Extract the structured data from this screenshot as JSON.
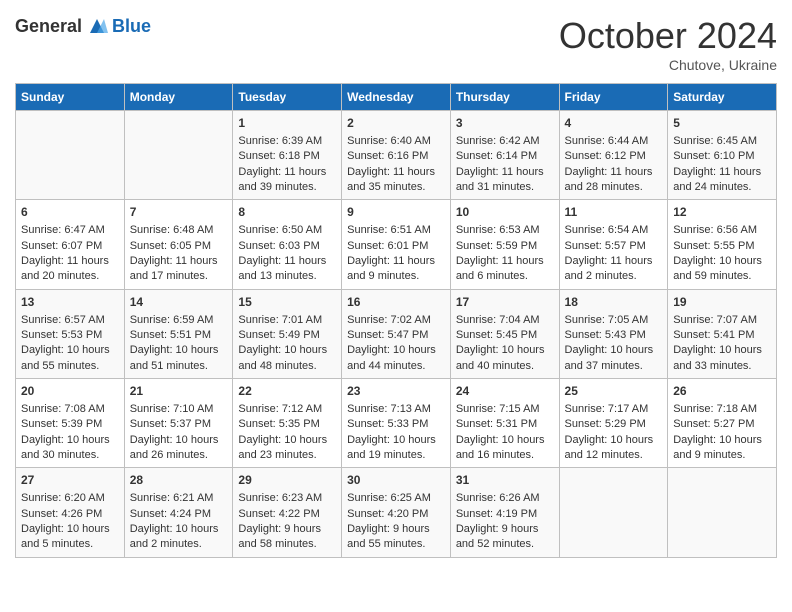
{
  "header": {
    "logo_general": "General",
    "logo_blue": "Blue",
    "month_title": "October 2024",
    "subtitle": "Chutove, Ukraine"
  },
  "days_of_week": [
    "Sunday",
    "Monday",
    "Tuesday",
    "Wednesday",
    "Thursday",
    "Friday",
    "Saturday"
  ],
  "weeks": [
    [
      {
        "day": "",
        "content": ""
      },
      {
        "day": "",
        "content": ""
      },
      {
        "day": "1",
        "content": "Sunrise: 6:39 AM\nSunset: 6:18 PM\nDaylight: 11 hours and 39 minutes."
      },
      {
        "day": "2",
        "content": "Sunrise: 6:40 AM\nSunset: 6:16 PM\nDaylight: 11 hours and 35 minutes."
      },
      {
        "day": "3",
        "content": "Sunrise: 6:42 AM\nSunset: 6:14 PM\nDaylight: 11 hours and 31 minutes."
      },
      {
        "day": "4",
        "content": "Sunrise: 6:44 AM\nSunset: 6:12 PM\nDaylight: 11 hours and 28 minutes."
      },
      {
        "day": "5",
        "content": "Sunrise: 6:45 AM\nSunset: 6:10 PM\nDaylight: 11 hours and 24 minutes."
      }
    ],
    [
      {
        "day": "6",
        "content": "Sunrise: 6:47 AM\nSunset: 6:07 PM\nDaylight: 11 hours and 20 minutes."
      },
      {
        "day": "7",
        "content": "Sunrise: 6:48 AM\nSunset: 6:05 PM\nDaylight: 11 hours and 17 minutes."
      },
      {
        "day": "8",
        "content": "Sunrise: 6:50 AM\nSunset: 6:03 PM\nDaylight: 11 hours and 13 minutes."
      },
      {
        "day": "9",
        "content": "Sunrise: 6:51 AM\nSunset: 6:01 PM\nDaylight: 11 hours and 9 minutes."
      },
      {
        "day": "10",
        "content": "Sunrise: 6:53 AM\nSunset: 5:59 PM\nDaylight: 11 hours and 6 minutes."
      },
      {
        "day": "11",
        "content": "Sunrise: 6:54 AM\nSunset: 5:57 PM\nDaylight: 11 hours and 2 minutes."
      },
      {
        "day": "12",
        "content": "Sunrise: 6:56 AM\nSunset: 5:55 PM\nDaylight: 10 hours and 59 minutes."
      }
    ],
    [
      {
        "day": "13",
        "content": "Sunrise: 6:57 AM\nSunset: 5:53 PM\nDaylight: 10 hours and 55 minutes."
      },
      {
        "day": "14",
        "content": "Sunrise: 6:59 AM\nSunset: 5:51 PM\nDaylight: 10 hours and 51 minutes."
      },
      {
        "day": "15",
        "content": "Sunrise: 7:01 AM\nSunset: 5:49 PM\nDaylight: 10 hours and 48 minutes."
      },
      {
        "day": "16",
        "content": "Sunrise: 7:02 AM\nSunset: 5:47 PM\nDaylight: 10 hours and 44 minutes."
      },
      {
        "day": "17",
        "content": "Sunrise: 7:04 AM\nSunset: 5:45 PM\nDaylight: 10 hours and 40 minutes."
      },
      {
        "day": "18",
        "content": "Sunrise: 7:05 AM\nSunset: 5:43 PM\nDaylight: 10 hours and 37 minutes."
      },
      {
        "day": "19",
        "content": "Sunrise: 7:07 AM\nSunset: 5:41 PM\nDaylight: 10 hours and 33 minutes."
      }
    ],
    [
      {
        "day": "20",
        "content": "Sunrise: 7:08 AM\nSunset: 5:39 PM\nDaylight: 10 hours and 30 minutes."
      },
      {
        "day": "21",
        "content": "Sunrise: 7:10 AM\nSunset: 5:37 PM\nDaylight: 10 hours and 26 minutes."
      },
      {
        "day": "22",
        "content": "Sunrise: 7:12 AM\nSunset: 5:35 PM\nDaylight: 10 hours and 23 minutes."
      },
      {
        "day": "23",
        "content": "Sunrise: 7:13 AM\nSunset: 5:33 PM\nDaylight: 10 hours and 19 minutes."
      },
      {
        "day": "24",
        "content": "Sunrise: 7:15 AM\nSunset: 5:31 PM\nDaylight: 10 hours and 16 minutes."
      },
      {
        "day": "25",
        "content": "Sunrise: 7:17 AM\nSunset: 5:29 PM\nDaylight: 10 hours and 12 minutes."
      },
      {
        "day": "26",
        "content": "Sunrise: 7:18 AM\nSunset: 5:27 PM\nDaylight: 10 hours and 9 minutes."
      }
    ],
    [
      {
        "day": "27",
        "content": "Sunrise: 6:20 AM\nSunset: 4:26 PM\nDaylight: 10 hours and 5 minutes."
      },
      {
        "day": "28",
        "content": "Sunrise: 6:21 AM\nSunset: 4:24 PM\nDaylight: 10 hours and 2 minutes."
      },
      {
        "day": "29",
        "content": "Sunrise: 6:23 AM\nSunset: 4:22 PM\nDaylight: 9 hours and 58 minutes."
      },
      {
        "day": "30",
        "content": "Sunrise: 6:25 AM\nSunset: 4:20 PM\nDaylight: 9 hours and 55 minutes."
      },
      {
        "day": "31",
        "content": "Sunrise: 6:26 AM\nSunset: 4:19 PM\nDaylight: 9 hours and 52 minutes."
      },
      {
        "day": "",
        "content": ""
      },
      {
        "day": "",
        "content": ""
      }
    ]
  ]
}
